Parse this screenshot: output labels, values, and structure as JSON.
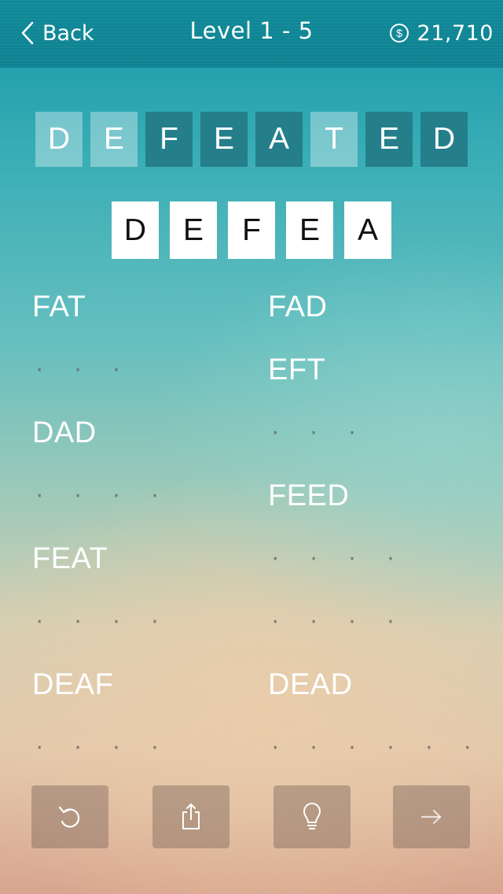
{
  "header": {
    "back_label": "Back",
    "title": "Level 1 - 5",
    "coins": "21,710",
    "back_icon": "chevron-left-icon",
    "coin_icon": "dollar-coin-icon"
  },
  "target_word": {
    "letters": [
      "D",
      "E",
      "F",
      "E",
      "A",
      "T",
      "E",
      "D"
    ],
    "states": [
      "used",
      "used",
      "free",
      "free",
      "free",
      "used",
      "free",
      "free"
    ]
  },
  "selected_letters": [
    "D",
    "E",
    "F",
    "E",
    "A"
  ],
  "word_list": {
    "left": [
      {
        "type": "word",
        "text": "FAT"
      },
      {
        "type": "dots",
        "text": "· · ·"
      },
      {
        "type": "word",
        "text": "DAD"
      },
      {
        "type": "dots",
        "text": "· · · ·"
      },
      {
        "type": "word",
        "text": "FEAT"
      },
      {
        "type": "dots",
        "text": "· · · ·"
      },
      {
        "type": "word",
        "text": "DEAF"
      },
      {
        "type": "dots",
        "text": "· · · ·"
      }
    ],
    "right": [
      {
        "type": "word",
        "text": "FAD"
      },
      {
        "type": "word",
        "text": "EFT"
      },
      {
        "type": "dots",
        "text": "· · ·"
      },
      {
        "type": "word",
        "text": "FEED"
      },
      {
        "type": "dots",
        "text": "· · · ·"
      },
      {
        "type": "dots",
        "text": "· · · ·"
      },
      {
        "type": "word",
        "text": "DEAD"
      },
      {
        "type": "dots",
        "text": "· · · · · ·"
      }
    ]
  },
  "toolbar": {
    "buttons": [
      "reset",
      "share",
      "hint",
      "next"
    ],
    "colors": {
      "button_bg": "#7a6258"
    }
  },
  "colors": {
    "header_bg": "#0f8a99",
    "tile_free": "#247f8b",
    "tile_used": "rgba(255,255,255,0.35)"
  }
}
